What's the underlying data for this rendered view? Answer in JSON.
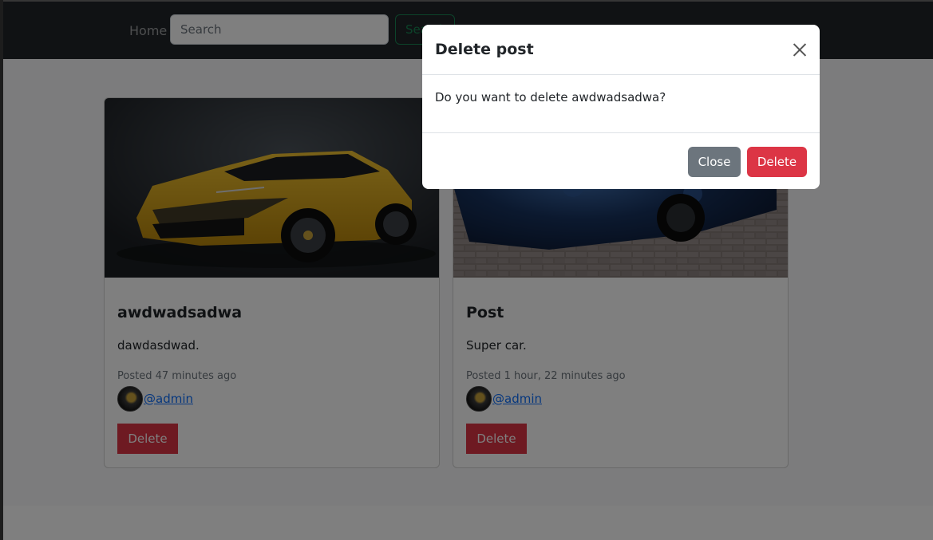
{
  "navbar": {
    "home_label": "Home",
    "search_placeholder": "Search",
    "search_button_label": "Search"
  },
  "posts": [
    {
      "title": "awdwadsadwa",
      "text": "dawdasdwad.",
      "posted": "Posted 47 minutes ago",
      "author": "@admin",
      "delete_label": "Delete",
      "image": "yellow-suv-image"
    },
    {
      "title": "Post",
      "text": "Super car.",
      "posted": "Posted 1 hour, 22 minutes ago",
      "author": "@admin",
      "delete_label": "Delete",
      "image": "wrapped-blue-car-image"
    }
  ],
  "modal": {
    "title": "Delete post",
    "message": "Do you want to delete awdwadsadwa?",
    "close_label": "Close",
    "delete_label": "Delete"
  },
  "colors": {
    "navbar": "#212529",
    "danger": "#dc3545",
    "secondary": "#6c757d",
    "success": "#198754",
    "link": "#0d6efd"
  }
}
